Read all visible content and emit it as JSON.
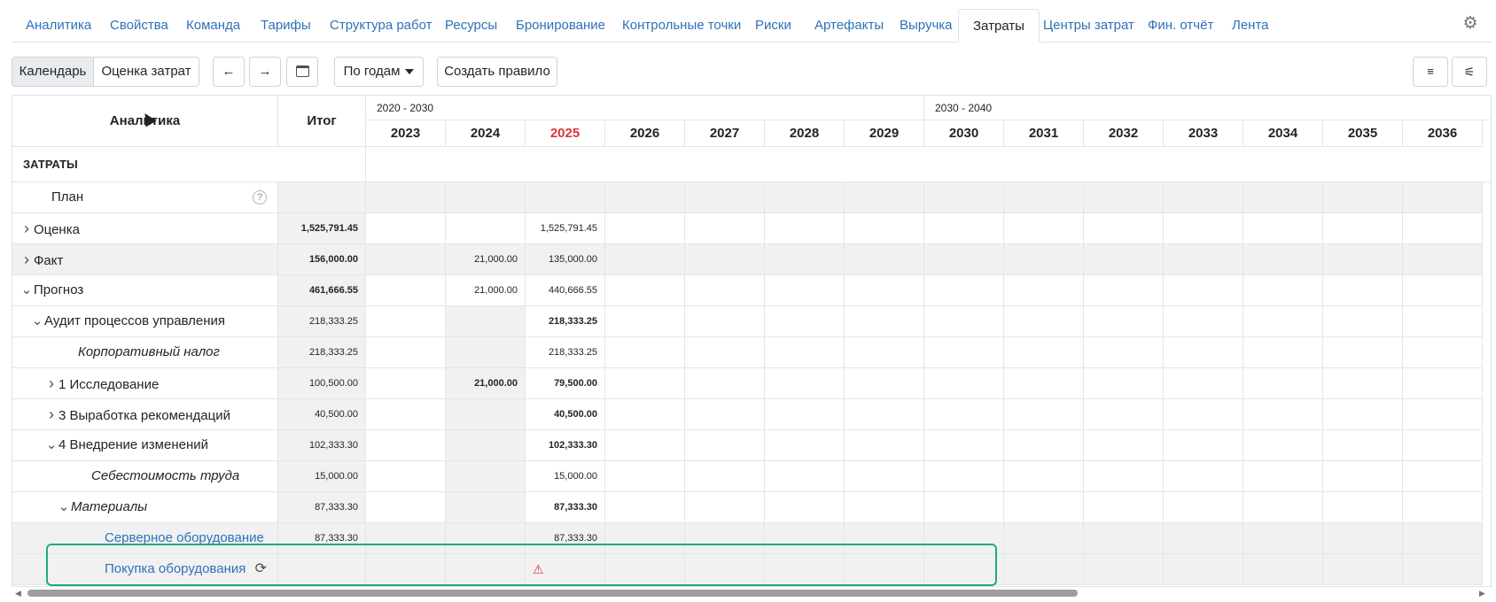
{
  "tabs": [
    "Аналитика",
    "Свойства",
    "Команда",
    "Тарифы",
    "Структура работ",
    "Ресурсы",
    "Бронирование",
    "Контрольные точки",
    "Риски",
    "Артефакты",
    "Выручка",
    "Затраты",
    "Центры затрат",
    "Фин. отчёт",
    "Лента"
  ],
  "active_tab": "Затраты",
  "toolbar": {
    "calendar": "Календарь",
    "estimate": "Оценка затрат",
    "prev": "←",
    "next": "→",
    "period": "По годам",
    "create_rule": "Создать правило"
  },
  "grid": {
    "col_analytics": "Аналитика",
    "col_total": "Итог",
    "decades": [
      "2020 - 2030",
      "2030 - 2040"
    ],
    "years": [
      "2023",
      "2024",
      "2025",
      "2026",
      "2027",
      "2028",
      "2029",
      "2030",
      "2031",
      "2032",
      "2033",
      "2034",
      "2035",
      "2036"
    ],
    "current_year": "2025",
    "section": "ЗАТРАТЫ",
    "rows": [
      {
        "label": "План",
        "total": "",
        "y2024": "",
        "y2025": ""
      },
      {
        "label": "Оценка",
        "total": "1,525,791.45",
        "y2024": "",
        "y2025": "1,525,791.45"
      },
      {
        "label": "Факт",
        "total": "156,000.00",
        "y2024": "21,000.00",
        "y2025": "135,000.00"
      },
      {
        "label": "Прогноз",
        "total": "461,666.55",
        "y2024": "21,000.00",
        "y2025": "440,666.55"
      },
      {
        "label": "Аудит процессов управления",
        "total": "218,333.25",
        "y2024": "",
        "y2025": "218,333.25"
      },
      {
        "label": "Корпоративный налог",
        "total": "218,333.25",
        "y2024": "",
        "y2025": "218,333.25"
      },
      {
        "label": "1 Исследование",
        "total": "100,500.00",
        "y2024": "21,000.00",
        "y2025": "79,500.00"
      },
      {
        "label": "3 Выработка рекомендаций",
        "total": "40,500.00",
        "y2024": "",
        "y2025": "40,500.00"
      },
      {
        "label": "4 Внедрение изменений",
        "total": "102,333.30",
        "y2024": "",
        "y2025": "102,333.30"
      },
      {
        "label": "Себестоимость труда",
        "total": "15,000.00",
        "y2024": "",
        "y2025": "15,000.00"
      },
      {
        "label": "Материалы",
        "total": "87,333.30",
        "y2024": "",
        "y2025": "87,333.30"
      },
      {
        "label": "Серверное оборудование",
        "total": "87,333.30",
        "y2024": "",
        "y2025": "87,333.30"
      },
      {
        "label": "Покупка оборудования",
        "total": "",
        "y2024": "",
        "y2025": "⚠"
      }
    ]
  },
  "icons": {
    "gear": "gear-icon",
    "help": "help-icon",
    "refresh": "refresh-icon",
    "warning": "warning-icon",
    "filter": "filter-icon",
    "settings": "sliders-icon"
  },
  "colors": {
    "link": "#2f71b8",
    "current_year": "#d9363e",
    "highlight": "#1ea98a",
    "warning": "#d9363e"
  }
}
